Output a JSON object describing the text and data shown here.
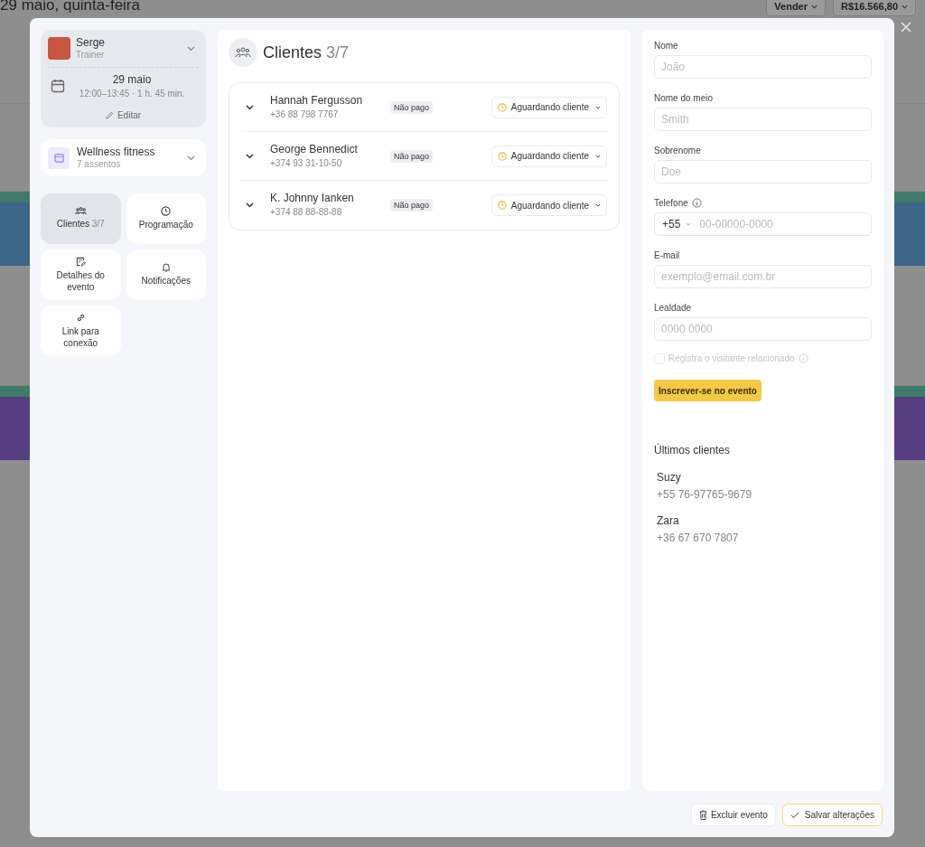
{
  "page": {
    "title": "29 maio, quinta-feira",
    "sell_button": "Vender",
    "balance_button": "R$16.566,80"
  },
  "trainer": {
    "name": "Serge",
    "role": "Trainer",
    "date": "29 maio",
    "time": "12:00–13:45 · 1 h. 45 min.",
    "edit": "Editar"
  },
  "service": {
    "name": "Wellness fitness",
    "seats": "7 assentos"
  },
  "nav": [
    {
      "kind": "clients",
      "label": "Clientes",
      "count": "3/7",
      "selected": true
    },
    {
      "kind": "schedule",
      "label": "Programação",
      "selected": false
    },
    {
      "kind": "details",
      "label": "Detalhes do evento",
      "selected": false
    },
    {
      "kind": "notifications",
      "label": "Notificações",
      "selected": false
    },
    {
      "kind": "link",
      "label": "Link para conexão",
      "selected": false
    }
  ],
  "clients_panel": {
    "title": "Clientes",
    "count": "3/7",
    "rows": [
      {
        "name": "Hannah Fergusson",
        "phone": "+36 88 798 7767",
        "payment": "Não pago",
        "status": "Aguardando cliente"
      },
      {
        "name": "George Bennedict",
        "phone": "+374 93 31-10-50",
        "payment": "Não pago",
        "status": "Aguardando cliente"
      },
      {
        "name": "K. Johnny Ianken",
        "phone": "+374 88 88-88-88",
        "payment": "Não pago",
        "status": "Aguardando cliente"
      }
    ]
  },
  "form": {
    "fields": [
      {
        "kind": "text",
        "label": "Nome",
        "placeholder": "João"
      },
      {
        "kind": "text",
        "label": "Nome do meio",
        "placeholder": "Smith"
      },
      {
        "kind": "text",
        "label": "Sobrenome",
        "placeholder": "Doe"
      },
      {
        "kind": "phone",
        "label": "Telefone",
        "country_code": "+55",
        "placeholder": "00-00000-0000"
      },
      {
        "kind": "text",
        "label": "E-mail",
        "placeholder": "exemplo@email.com.br"
      },
      {
        "kind": "text",
        "label": "Lealdade",
        "placeholder": "0000 0000"
      }
    ],
    "related_visitor": {
      "label": "Registra o visitante relacionado",
      "checked": false,
      "disabled": true
    },
    "submit": "Inscrever-se no evento"
  },
  "recent": {
    "title": "Últimos clientes",
    "clients": [
      {
        "name": "Suzy",
        "phone": "+55 76-97765-9679"
      },
      {
        "name": "Zara",
        "phone": "+36 67 670 7807"
      }
    ]
  },
  "footer": {
    "delete": "Excluir evento",
    "save": "Salvar alterações"
  }
}
